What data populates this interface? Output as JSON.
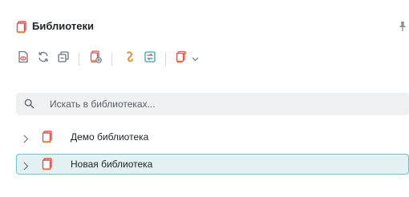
{
  "panel": {
    "title": "Библиотеки",
    "header_icon": "library-icon",
    "pin_icon": "pin-icon"
  },
  "toolbar": {
    "buttons": [
      {
        "name": "preview-library-button",
        "icon": "document-eye-icon"
      },
      {
        "name": "refresh-button",
        "icon": "refresh-icon"
      },
      {
        "name": "collapse-all-button",
        "icon": "collapse-icon"
      },
      {
        "name": "add-library-button",
        "icon": "library-add-icon"
      },
      {
        "name": "hook-button",
        "icon": "hook-icon"
      },
      {
        "name": "import-button",
        "icon": "import-icon"
      },
      {
        "name": "export-menu-button",
        "icon": "library-export-icon"
      }
    ]
  },
  "search": {
    "placeholder": "Искать в библиотеках...",
    "value": ""
  },
  "tree": {
    "items": [
      {
        "label": "Демо библиотека",
        "selected": false,
        "expanded": false
      },
      {
        "label": "Новая библиотека",
        "selected": true,
        "expanded": false
      }
    ]
  },
  "colors": {
    "accent_red": "#d9534f",
    "accent_orange": "#e8892a",
    "accent_teal": "#2fa3ad",
    "selection_bg": "#e3f1f2",
    "selection_border": "#6cc3c9",
    "search_bg": "#eef0f2"
  }
}
